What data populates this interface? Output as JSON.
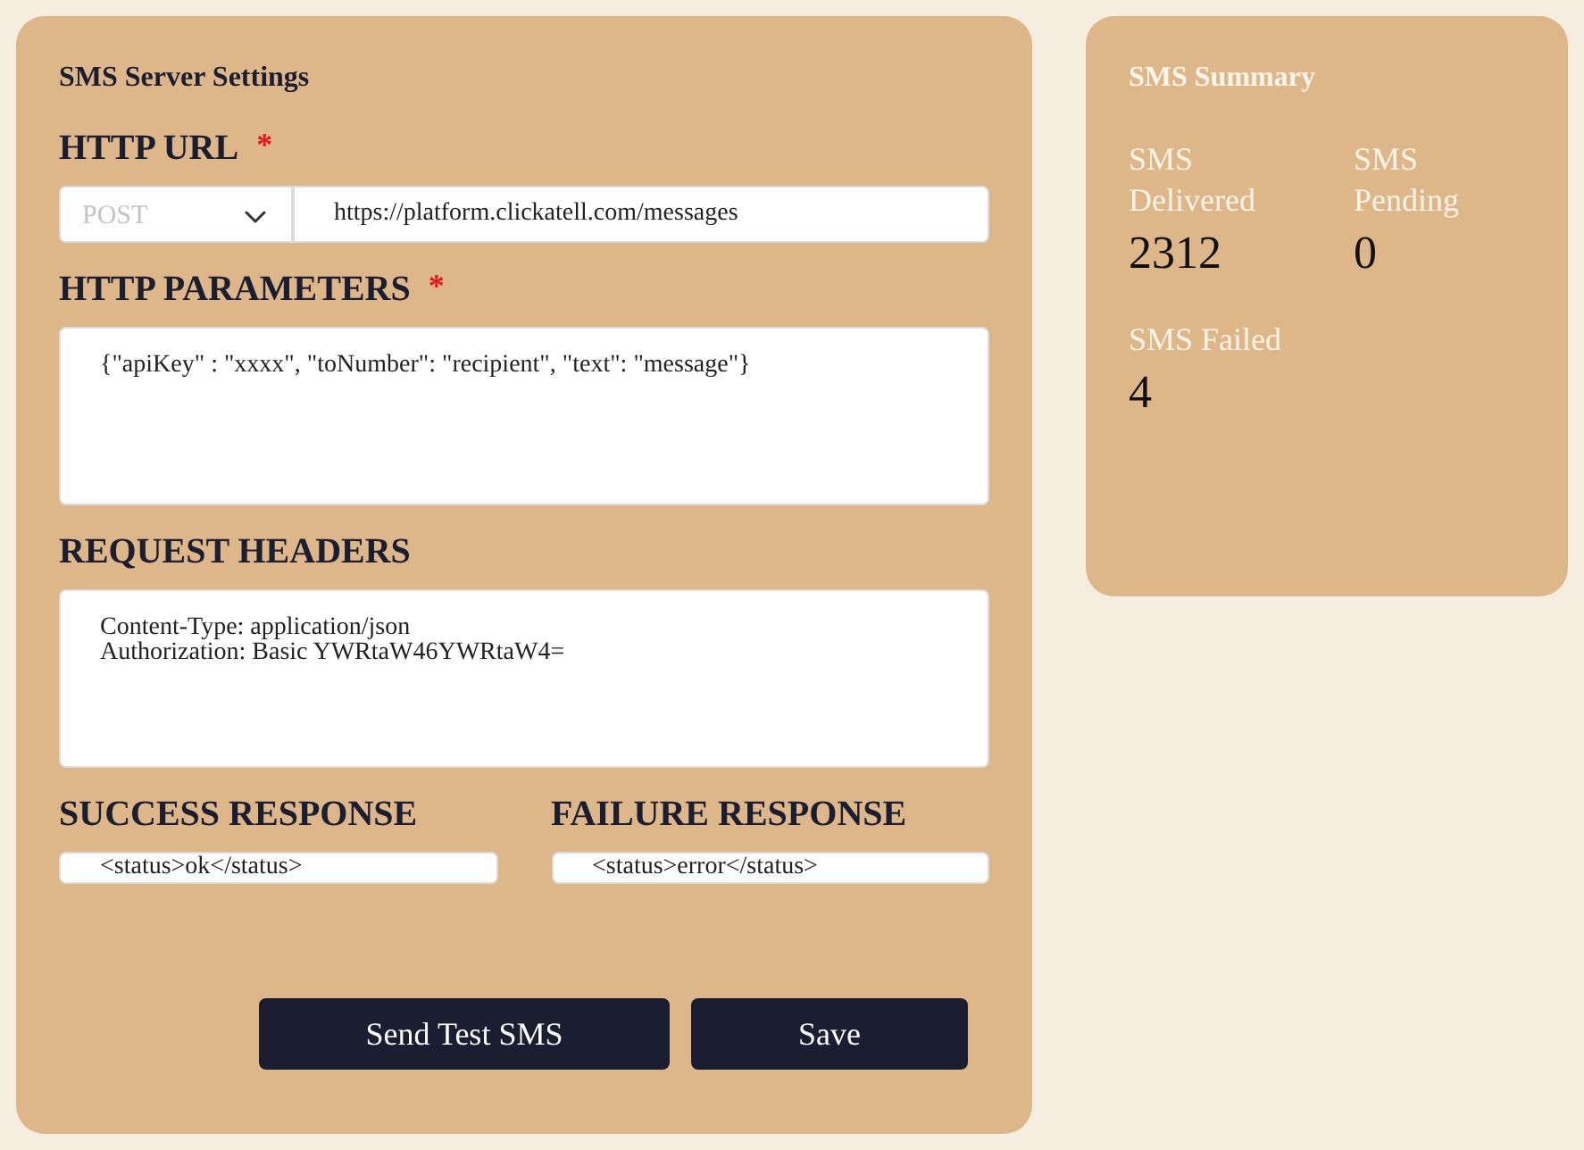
{
  "settings": {
    "title": "SMS Server Settings",
    "sections": [
      {
        "kind": "url",
        "label": "HTTP URL",
        "required_mark": "*",
        "method": {
          "placeholder": "POST"
        },
        "value": "https://platform.clickatell.com/messages"
      },
      {
        "kind": "textarea",
        "label": "HTTP PARAMETERS",
        "required_mark": "*",
        "value": "{\"apiKey\" : \"xxxx\", \"toNumber\": \"recipient\", \"text\": \"message\"}"
      },
      {
        "kind": "textarea",
        "label": "REQUEST HEADERS",
        "value": "Content-Type: application/json\nAuthorization: Basic YWRtaW46YWRtaW4="
      }
    ],
    "responses": [
      {
        "label": "SUCCESS RESPONSE",
        "value": "<status>ok</status>"
      },
      {
        "label": "FAILURE RESPONSE",
        "value": "<status>error</status>"
      }
    ],
    "buttons": [
      "Send Test SMS",
      "Save"
    ]
  },
  "summary": {
    "title": "SMS Summary",
    "stats": [
      {
        "label": "SMS Delivered",
        "value": "2312"
      },
      {
        "label": "SMS Pending",
        "value": "0"
      },
      {
        "label": "SMS Failed",
        "value": "4"
      }
    ]
  }
}
